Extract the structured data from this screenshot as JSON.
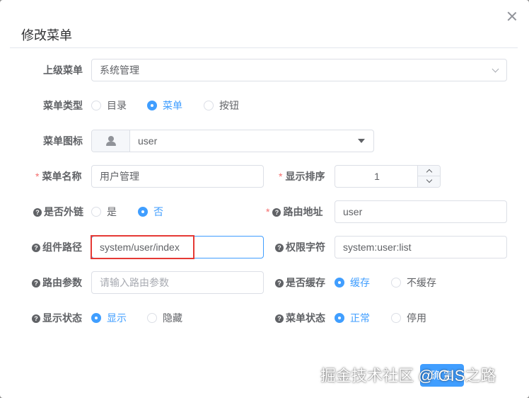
{
  "dialog": {
    "title": "修改菜单"
  },
  "form": {
    "parent_menu": {
      "label": "上级菜单",
      "value": "系统管理"
    },
    "menu_type": {
      "label": "菜单类型",
      "options": [
        "目录",
        "菜单",
        "按钮"
      ],
      "selected": "菜单"
    },
    "menu_icon": {
      "label": "菜单图标",
      "value": "user"
    },
    "menu_name": {
      "label": "菜单名称",
      "value": "用户管理"
    },
    "display_order": {
      "label": "显示排序",
      "value": "1"
    },
    "is_external": {
      "label": "是否外链",
      "options": [
        "是",
        "否"
      ],
      "selected": "否"
    },
    "route_path": {
      "label": "路由地址",
      "value": "user"
    },
    "component_path": {
      "label": "组件路径",
      "value": "system/user/index"
    },
    "permission": {
      "label": "权限字符",
      "value": "system:user:list"
    },
    "route_params": {
      "label": "路由参数",
      "placeholder": "请输入路由参数"
    },
    "is_cache": {
      "label": "是否缓存",
      "options": [
        "缓存",
        "不缓存"
      ],
      "selected": "缓存"
    },
    "visible": {
      "label": "显示状态",
      "options": [
        "显示",
        "隐藏"
      ],
      "selected": "显示"
    },
    "status": {
      "label": "菜单状态",
      "options": [
        "正常",
        "停用"
      ],
      "selected": "正常"
    }
  },
  "footer": {
    "confirm_label": "确 定"
  },
  "watermark": "掘金技术社区 @ GIS之路",
  "colors": {
    "primary": "#409eff",
    "required": "#f56c6c",
    "highlight_box": "#e53935"
  }
}
